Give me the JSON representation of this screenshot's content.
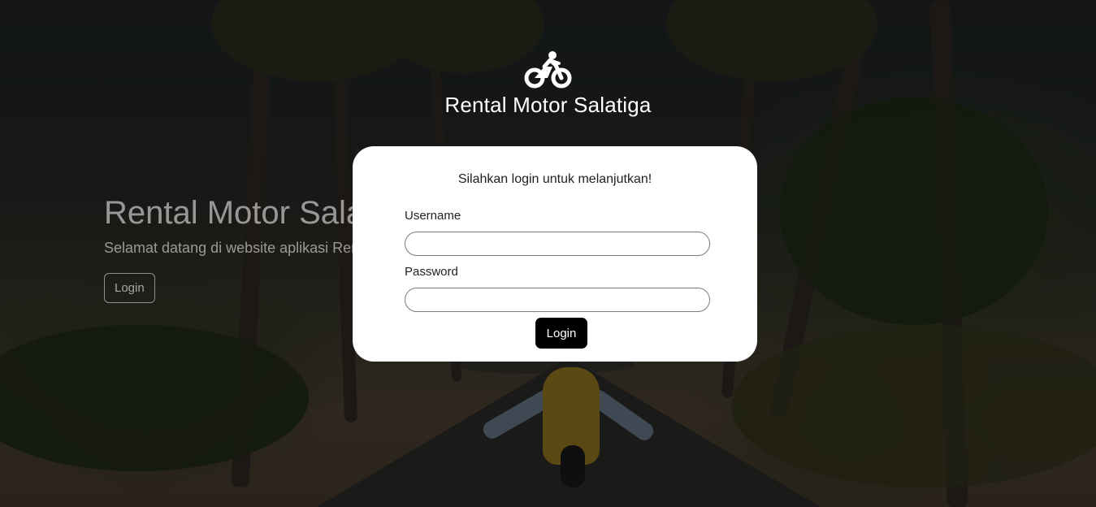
{
  "brand": {
    "icon": "motorcycle-icon",
    "title": "Rental Motor Salatiga"
  },
  "hero": {
    "title": "Rental Motor Salatiga",
    "subtitle": "Selamat datang di website aplikasi Rental Motor Salatiga",
    "login_label": "Login"
  },
  "login_modal": {
    "message": "Silahkan login untuk melanjutkan!",
    "username_label": "Username",
    "username_value": "",
    "password_label": "Password",
    "password_value": "",
    "submit_label": "Login"
  },
  "colors": {
    "modal_background": "#ffffff",
    "button_background": "#000000",
    "overlay": "rgba(0,0,0,0.55)"
  }
}
